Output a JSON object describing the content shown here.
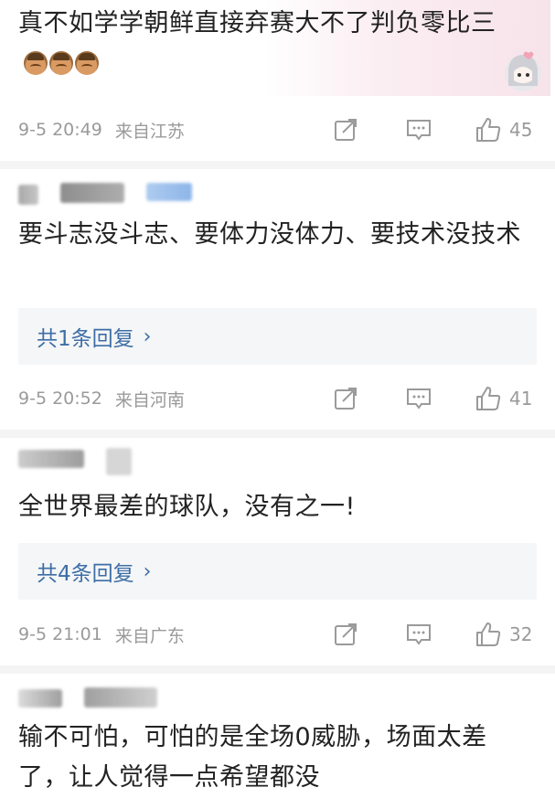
{
  "comments": [
    {
      "text": "真不如学学朝鲜直接弃赛大不了判负零比三",
      "emoji": [
        "face-emoji",
        "face-emoji",
        "face-emoji"
      ],
      "time": "9-5 20:49",
      "location": "来自江苏",
      "likes": "45"
    },
    {
      "text": "要斗志没斗志、要体力没体力、要技术没技术",
      "reply_label": "共1条回复",
      "time": "9-5 20:52",
      "location": "来自河南",
      "likes": "41"
    },
    {
      "text": "全世界最差的球队，没有之一!",
      "reply_label": "共4条回复",
      "time": "9-5 21:01",
      "location": "来自广东",
      "likes": "32"
    },
    {
      "text": "输不可怕，可怕的是全场0威胁，场面太差了，让人觉得一点希望都没"
    }
  ],
  "icons": {
    "share": "share-icon",
    "comment": "comment-icon",
    "like": "thumbs-up-icon",
    "chevron": "chevron-right-icon"
  },
  "colors": {
    "meta_gray": "#9a9a9a",
    "reply_blue": "#3d6ea6",
    "divider": "#f4f4f4"
  }
}
